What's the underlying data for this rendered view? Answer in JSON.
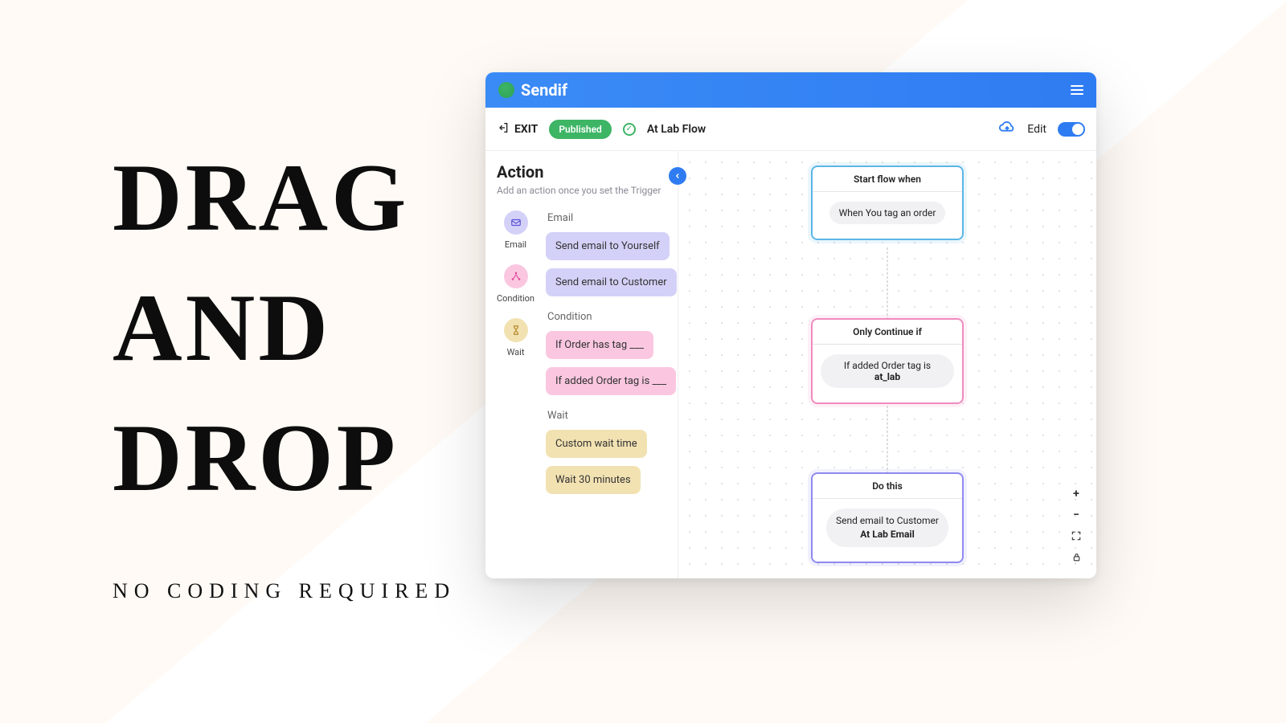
{
  "hero": {
    "line1": "DRAG",
    "line2": "AND",
    "line3": "DROP",
    "sub": "NO CODING REQUIRED"
  },
  "app": {
    "brand": "Sendif"
  },
  "toolbar": {
    "exit": "EXIT",
    "status_badge": "Published",
    "flow_name": "At Lab Flow",
    "edit_label": "Edit"
  },
  "panel": {
    "title": "Action",
    "hint": "Add an action once you set the Trigger",
    "cats": {
      "email": "Email",
      "condition": "Condition",
      "wait": "Wait"
    },
    "groups": {
      "email_label": "Email",
      "email_items": [
        "Send email to Yourself",
        "Send email to Customer"
      ],
      "cond_label": "Condition",
      "cond_items": [
        "If Order has tag ___",
        "If added Order tag is ___"
      ],
      "wait_label": "Wait",
      "wait_items": [
        "Custom wait time",
        "Wait 30 minutes"
      ]
    }
  },
  "canvas": {
    "n1": {
      "head": "Start flow when",
      "chip": "When You tag an order"
    },
    "n2": {
      "head": "Only Continue if",
      "chip_pre": "If added Order tag is ",
      "chip_bold": "at_lab"
    },
    "n3": {
      "head": "Do this",
      "chip_line1": "Send email to Customer",
      "chip_line2": "At Lab Email"
    }
  }
}
